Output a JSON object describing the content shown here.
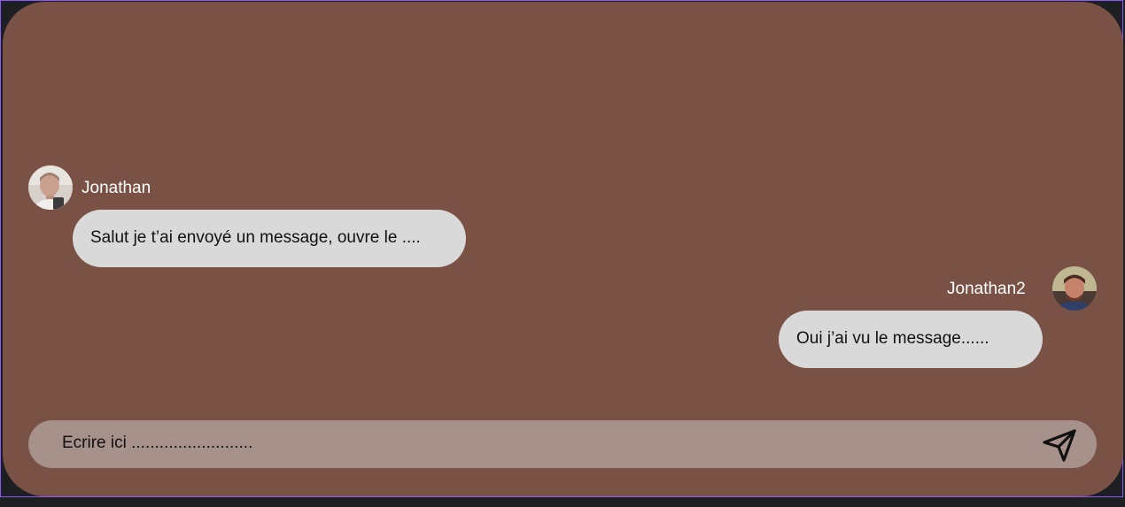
{
  "messages": [
    {
      "author": "Jonathan",
      "text": "Salut je t’ai envoyé un message, ouvre le ....",
      "side": "left"
    },
    {
      "author": "Jonathan2",
      "text": "Oui j’ai vu le message......",
      "side": "right"
    }
  ],
  "composer": {
    "placeholder": "Ecrire ici ..........................",
    "send_icon": "send-icon"
  },
  "colors": {
    "window_bg": "#795245",
    "bubble_bg": "#d9d9d9",
    "composer_bg": "#a6918b",
    "frame_border": "#8a5cf6"
  }
}
